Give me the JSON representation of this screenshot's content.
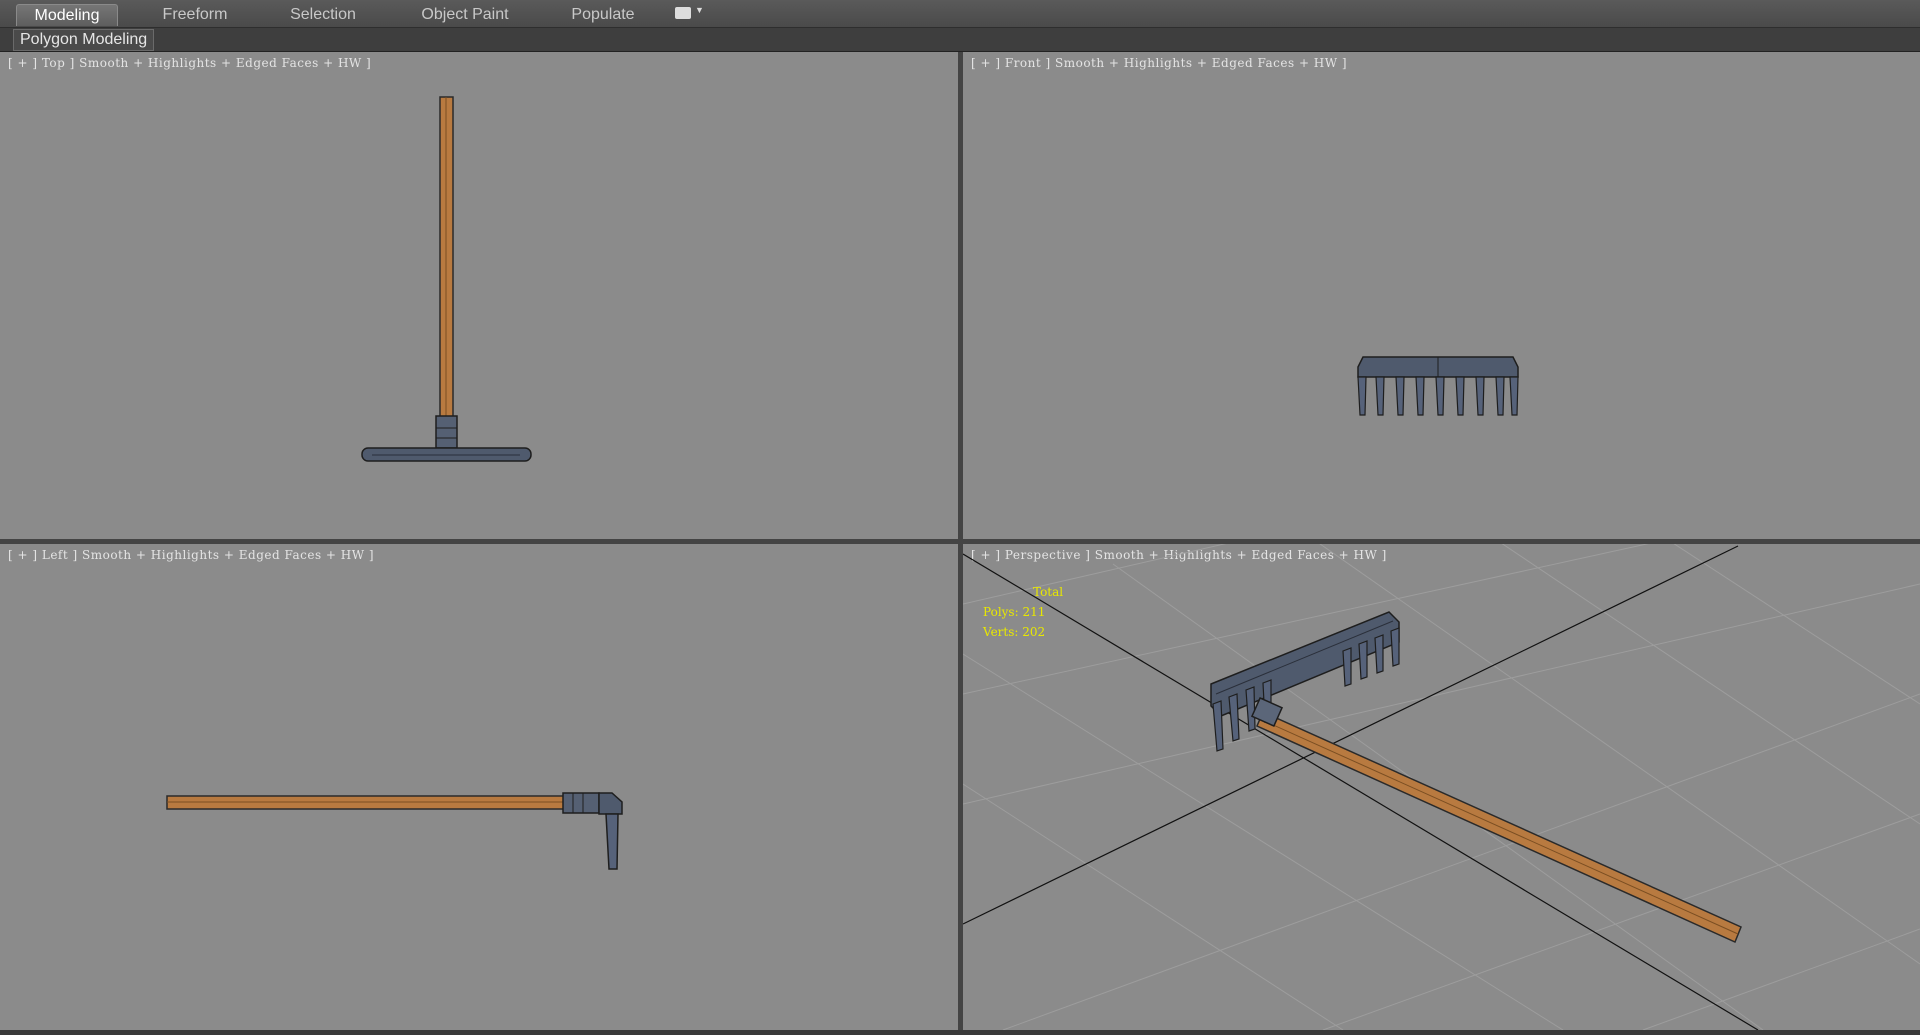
{
  "ribbon": {
    "tabs": [
      {
        "label": "Modeling",
        "active": true
      },
      {
        "label": "Freeform",
        "active": false
      },
      {
        "label": "Selection",
        "active": false
      },
      {
        "label": "Object Paint",
        "active": false
      },
      {
        "label": "Populate",
        "active": false
      }
    ],
    "subtab": "Polygon Modeling"
  },
  "viewports": {
    "top": {
      "label": "[ + ] Top ] Smooth + Highlights + Edged Faces + HW ]"
    },
    "front": {
      "label": "[ + ] Front ] Smooth + Highlights + Edged Faces + HW ]"
    },
    "left": {
      "label": "[ + ] Left ] Smooth + Highlights + Edged Faces + HW ]"
    },
    "perspective": {
      "label": "[ + ] Perspective ] Smooth + Highlights + Edged Faces + HW ]"
    }
  },
  "stats": {
    "title": "Total",
    "polys": "Polys: 211",
    "verts": "Verts: 202"
  },
  "colors": {
    "viewport_bg": "#8b8b8b",
    "handle_wood": "#b87a40",
    "rake_head_metal": "#4f5a6d",
    "stats_text": "#e8e800"
  }
}
